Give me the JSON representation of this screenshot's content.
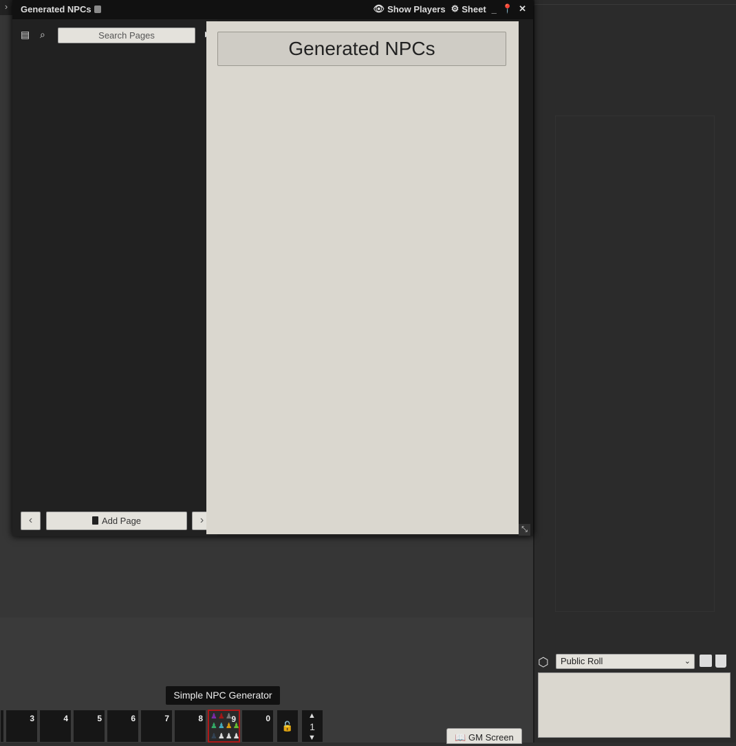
{
  "journal": {
    "title": "Generated NPCs",
    "controls": {
      "show_players": "Show Players",
      "sheet": "Sheet",
      "minimize": "_",
      "close": "✕"
    }
  },
  "pages_panel": {
    "search_placeholder": "Search Pages",
    "add_page_label": "Add Page",
    "prev_icon": "chevron-left-icon",
    "next_icon": "chevron-right-icon"
  },
  "page": {
    "title": "Generated NPCs"
  },
  "tooltip": {
    "text": "Simple NPC Generator"
  },
  "hotbar": {
    "slots": [
      "",
      "3",
      "4",
      "5",
      "6",
      "7",
      "8",
      "9",
      "0"
    ],
    "active_slot": "9",
    "page": "1"
  },
  "gm_screen_label": "GM Screen",
  "chat": {
    "roll_mode": "Public Roll"
  },
  "colors": {
    "parchment": "#dad7cf",
    "active_slot_border": "#b01818",
    "dark_bg": "#1e1e1e"
  }
}
